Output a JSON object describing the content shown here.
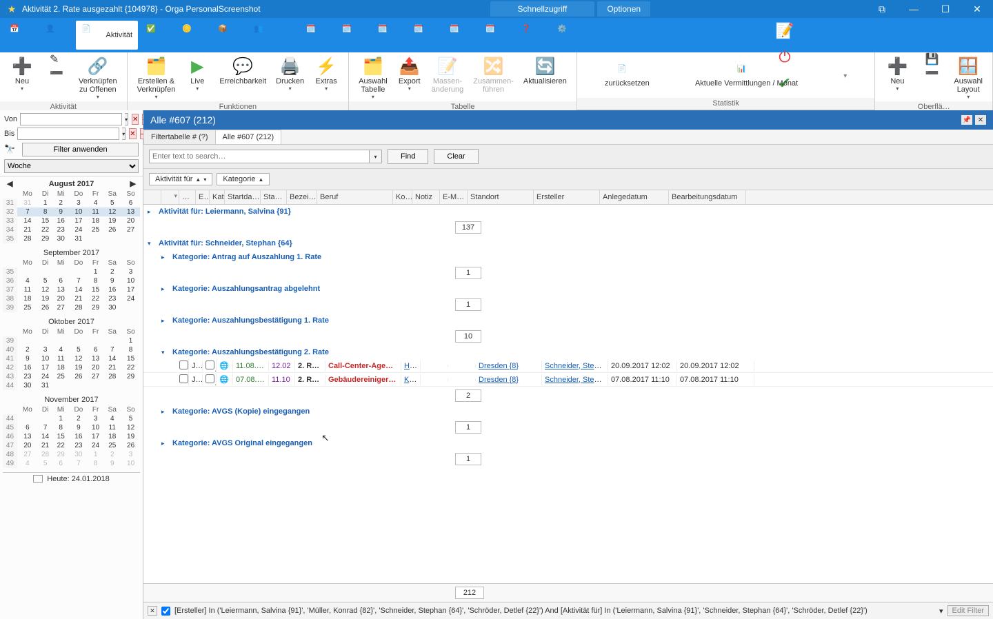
{
  "titlebar": {
    "title": "Aktivität 2. Rate ausgezahlt {104978} - Orga PersonalScreenshot",
    "quick_access": "Schnellzugriff",
    "options": "Optionen"
  },
  "ribbon1": {
    "activity_label": "Aktivität"
  },
  "ribbon2": {
    "groups": {
      "aktivitaet": {
        "label": "Aktivität",
        "neu": "Neu",
        "verknuepfen": "Verknüpfen\nzu Offenen"
      },
      "funktionen": {
        "label": "Funktionen",
        "erstellen": "Erstellen &\nVerknüpfen",
        "live": "Live",
        "erreich": "Erreichbarkeit",
        "drucken": "Drucken",
        "extras": "Extras"
      },
      "tabelle": {
        "label": "Tabelle",
        "auswahl": "Auswahl\nTabelle",
        "export": "Export",
        "massen": "Massen-\nänderung",
        "zusammen": "Zusammen-\nführen",
        "aktual": "Aktualisieren"
      },
      "statistik": {
        "label": "Statistik",
        "reset": "zurücksetzen",
        "aktuelle": "Aktuelle Vermittlungen / Monat"
      },
      "rightside": {
        "neu": "Neu",
        "layout": "Auswahl\nLayout",
        "group_label": "Oberflä…"
      }
    }
  },
  "left": {
    "von": "Von",
    "bis": "Bis",
    "apply": "Filter anwenden",
    "period": "Woche",
    "today": "Heute: 24.01.2018",
    "months": [
      {
        "name": "August 2017",
        "wk": [
          31,
          32,
          33,
          34,
          35
        ],
        "dow": [
          "Mo",
          "Di",
          "Mi",
          "Do",
          "Fr",
          "Sa",
          "So"
        ],
        "rows": [
          [
            "31",
            "1",
            "2",
            "3",
            "4",
            "5",
            "6"
          ],
          [
            "7",
            "8",
            "9",
            "10",
            "11",
            "12",
            "13"
          ],
          [
            "14",
            "15",
            "16",
            "17",
            "18",
            "19",
            "20"
          ],
          [
            "21",
            "22",
            "23",
            "24",
            "25",
            "26",
            "27"
          ],
          [
            "28",
            "29",
            "30",
            "31",
            "",
            "",
            ""
          ]
        ],
        "dim": [
          [
            0
          ]
        ],
        "hl": [
          1
        ]
      },
      {
        "name": "September 2017",
        "wk": [
          35,
          36,
          37,
          38,
          39
        ],
        "dow": [
          "Mo",
          "Di",
          "Mi",
          "Do",
          "Fr",
          "Sa",
          "So"
        ],
        "rows": [
          [
            "",
            "",
            "",
            "",
            "1",
            "2",
            "3"
          ],
          [
            "4",
            "5",
            "6",
            "7",
            "8",
            "9",
            "10"
          ],
          [
            "11",
            "12",
            "13",
            "14",
            "15",
            "16",
            "17"
          ],
          [
            "18",
            "19",
            "20",
            "21",
            "22",
            "23",
            "24"
          ],
          [
            "25",
            "26",
            "27",
            "28",
            "29",
            "30",
            ""
          ]
        ]
      },
      {
        "name": "Oktober 2017",
        "wk": [
          39,
          40,
          41,
          42,
          43,
          44
        ],
        "dow": [
          "Mo",
          "Di",
          "Mi",
          "Do",
          "Fr",
          "Sa",
          "So"
        ],
        "rows": [
          [
            "",
            "",
            "",
            "",
            "",
            "",
            "1"
          ],
          [
            "2",
            "3",
            "4",
            "5",
            "6",
            "7",
            "8"
          ],
          [
            "9",
            "10",
            "11",
            "12",
            "13",
            "14",
            "15"
          ],
          [
            "16",
            "17",
            "18",
            "19",
            "20",
            "21",
            "22"
          ],
          [
            "23",
            "24",
            "25",
            "26",
            "27",
            "28",
            "29"
          ],
          [
            "30",
            "31",
            "",
            "",
            "",
            "",
            ""
          ]
        ]
      },
      {
        "name": "November 2017",
        "wk": [
          44,
          45,
          46,
          47,
          48,
          49
        ],
        "dow": [
          "Mo",
          "Di",
          "Mi",
          "Do",
          "Fr",
          "Sa",
          "So"
        ],
        "rows": [
          [
            "",
            "",
            "1",
            "2",
            "3",
            "4",
            "5"
          ],
          [
            "6",
            "7",
            "8",
            "9",
            "10",
            "11",
            "12"
          ],
          [
            "13",
            "14",
            "15",
            "16",
            "17",
            "18",
            "19"
          ],
          [
            "20",
            "21",
            "22",
            "23",
            "24",
            "25",
            "26"
          ],
          [
            "27",
            "28",
            "29",
            "30",
            "1",
            "2",
            "3"
          ],
          [
            "4",
            "5",
            "6",
            "7",
            "8",
            "9",
            "10"
          ]
        ],
        "dimrows": [
          4,
          5
        ]
      }
    ]
  },
  "view": {
    "header": "Alle #607 (212)",
    "tab1": "Filtertabelle # (?)",
    "tab2": "Alle #607 (212)",
    "search_placeholder": "Enter text to search…",
    "find": "Find",
    "clear": "Clear",
    "chip1": "Aktivität für",
    "chip2": "Kategorie"
  },
  "columns": [
    "",
    "…",
    "E…",
    "Kat…",
    "Startda…",
    "Sta…",
    "Bezei…",
    "Beruf",
    "Ko…",
    "Notiz",
    "E-M…",
    "Standort",
    "Ersteller",
    "Anlegedatum",
    "Bearbeitungsdatum"
  ],
  "groups": [
    {
      "label": "Aktivität für: Leiermann, Salvina {91}",
      "count": "137",
      "expanded": false
    },
    {
      "label": "Aktivität für: Schneider, Stephan {64}",
      "expanded": true,
      "sub": [
        {
          "label": "Kategorie: Antrag auf Auszahlung 1. Rate",
          "count": "1"
        },
        {
          "label": "Kategorie: Auszahlungsantrag abgelehnt",
          "count": "1"
        },
        {
          "label": "Kategorie: Auszahlungsbestätigung 1. Rate",
          "count": "10"
        },
        {
          "label": "Kategorie: Auszahlungsbestätigung 2. Rate",
          "count": "2",
          "expanded": true,
          "rows": [
            {
              "ja": "Ja",
              "start": "11.08.2…",
              "sta": "12.02",
              "bez": "2. R…",
              "beruf": "Call-Center-Age…",
              "ko": "He…",
              "standort": "Dresden {8}",
              "ersteller": "Schneider, Steph…",
              "anlege": "20.09.2017 12:02",
              "bearb": "20.09.2017 12:02",
              "startcolor": "grn",
              "stacolor": "pur",
              "berufred": true
            },
            {
              "ja": "Ja",
              "start": "07.08.2…",
              "sta": "11.10",
              "bez": "2. R…",
              "beruf": "Gebäudereiniger…",
              "ko": "Kla…",
              "standort": "Dresden {8}",
              "ersteller": "Schneider, Steph…",
              "anlege": "07.08.2017 11:10",
              "bearb": "07.08.2017 11:10",
              "startcolor": "grn",
              "stacolor": "pur",
              "berufred": true
            }
          ]
        },
        {
          "label": "Kategorie: AVGS (Kopie) eingegangen",
          "count": "1"
        },
        {
          "label": "Kategorie: AVGS Original eingegangen",
          "count": "1"
        }
      ]
    }
  ],
  "total": "212",
  "filterfoot": "[Ersteller] In ('Leiermann, Salvina {91}', 'Müller, Konrad {82}', 'Schneider, Stephan {64}', 'Schröder, Detlef {22}') And [Aktivität für] In ('Leiermann, Salvina {91}', 'Schneider, Stephan {64}', 'Schröder, Detlef {22}')",
  "editfilter": "Edit Filter"
}
